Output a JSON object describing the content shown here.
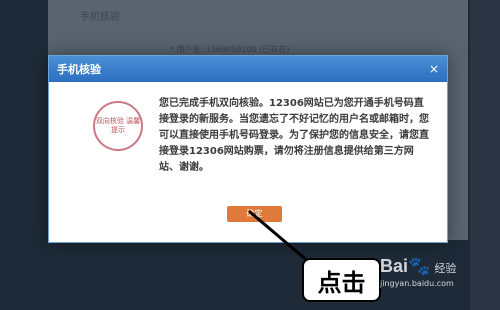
{
  "background": {
    "page_title": "手机核验",
    "line_text": "* 用户名: 1369059200 (已存在)"
  },
  "dialog": {
    "title": "手机核验",
    "close_glyph": "×",
    "stamp_text": "双向核验 温馨提示",
    "message": "您已完成手机双向核验。12306网站已为您开通手机号码直接登录的新服务。当您遗忘了不好记忆的用户名或邮箱时，您可以直接使用手机号码登录。为了保护您的信息安全，请您直接登录12306网站购票，请勿将注册信息提供给第三方网站、谢谢。",
    "ok_label": "确定"
  },
  "annotation": {
    "callout_text": "点击"
  },
  "watermark": {
    "brand": "Bai",
    "brand_paw": "🐾",
    "brand_suffix": "经验",
    "url": "jingyan.baidu.com"
  },
  "colors": {
    "header": "#2b6fbf",
    "button": "#e07a3a",
    "stamp": "#c0525f"
  }
}
